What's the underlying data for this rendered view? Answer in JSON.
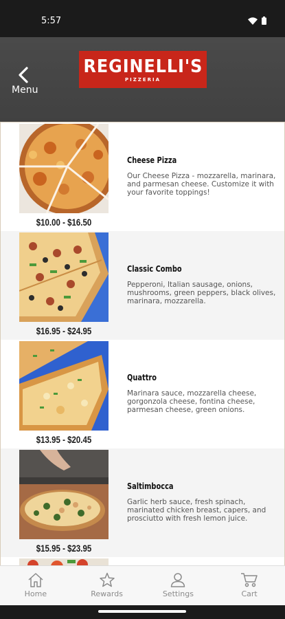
{
  "status_bar": {
    "time": "5:57"
  },
  "header": {
    "back_label": "Menu",
    "logo_title": "REGINELLI'S",
    "logo_subtitle": "PIZZERIA"
  },
  "menu_items": [
    {
      "name": "Cheese Pizza",
      "description": "Our Cheese Pizza - mozzarella, marinara, and parmesan cheese. Customize it with your favorite toppings!",
      "price": "$10.00 - $16.50"
    },
    {
      "name": "Classic Combo",
      "description": "Pepperoni, Italian sausage, onions, mushrooms, green peppers, black olives, marinara, mozzarella.",
      "price": "$16.95 - $24.95"
    },
    {
      "name": "Quattro",
      "description": "Marinara sauce, mozzarella cheese, gorgonzola cheese, fontina cheese, parmesan cheese, green onions.",
      "price": "$13.95 - $20.45"
    },
    {
      "name": "Saltimbocca",
      "description": "Garlic herb sauce, fresh spinach, marinated chicken breast, capers, and prosciutto with fresh lemon juice.",
      "price": "$15.95 - $23.95"
    }
  ],
  "tabs": [
    {
      "label": "Home",
      "icon": "home-icon"
    },
    {
      "label": "Rewards",
      "icon": "star-icon"
    },
    {
      "label": "Settings",
      "icon": "person-icon"
    },
    {
      "label": "Cart",
      "icon": "cart-icon"
    }
  ],
  "colors": {
    "brand_red": "#c8261a",
    "header_bg": "#454545",
    "tab_icon_gray": "#8a8a8a"
  }
}
